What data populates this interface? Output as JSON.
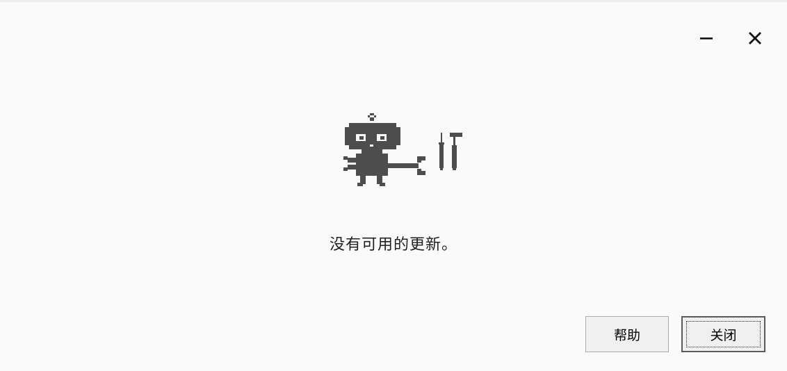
{
  "window_controls": {
    "minimize_icon": "minimize-icon",
    "close_icon": "close-icon"
  },
  "illustration": {
    "robot_icon": "robot-with-wrench-icon",
    "tools_icon": "screwdriver-hammer-icon",
    "color": "#4d4d4d"
  },
  "message": "没有可用的更新。",
  "buttons": {
    "help_label": "帮助",
    "close_label": "关闭"
  }
}
